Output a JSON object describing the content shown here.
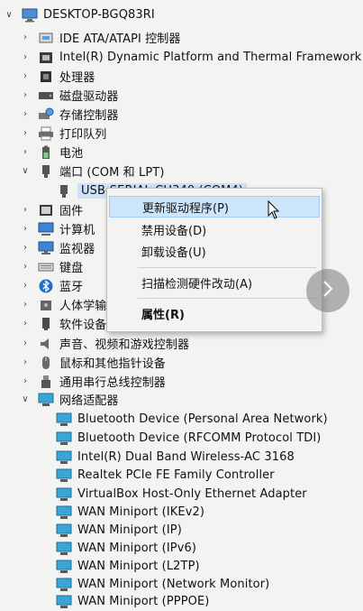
{
  "root": {
    "label": "DESKTOP-BGQ83RI"
  },
  "tree": {
    "collapsed": [
      {
        "name": "node-ide",
        "label": "IDE ATA/ATAPI 控制器",
        "icon": "ide-controller-icon"
      },
      {
        "name": "node-intel-dptf",
        "label": "Intel(R) Dynamic Platform and Thermal Framework",
        "icon": "intel-framework-icon"
      },
      {
        "name": "node-processor",
        "label": "处理器",
        "icon": "processor-icon"
      },
      {
        "name": "node-disk-drives",
        "label": "磁盘驱动器",
        "icon": "disk-drive-icon"
      },
      {
        "name": "node-storage-controllers",
        "label": "存储控制器",
        "icon": "storage-controller-icon"
      },
      {
        "name": "node-print-queues",
        "label": "打印队列",
        "icon": "printer-icon"
      },
      {
        "name": "node-battery",
        "label": "电池",
        "icon": "battery-icon"
      }
    ],
    "ports": {
      "label": "端口 (COM 和 LPT)",
      "child": "USB-SERIAL CH340 (COM4)"
    },
    "after_ports": [
      {
        "name": "node-firmware",
        "label": "固件",
        "icon": "firmware-icon"
      },
      {
        "name": "node-computer",
        "label": "计算机",
        "icon": "computer-icon"
      },
      {
        "name": "node-monitors",
        "label": "监视器",
        "icon": "monitor-icon"
      },
      {
        "name": "node-keyboards",
        "label": "键盘",
        "icon": "keyboard-icon"
      },
      {
        "name": "node-bluetooth",
        "label": "蓝牙",
        "icon": "bluetooth-icon"
      },
      {
        "name": "node-hid",
        "label": "人体学输入设备",
        "icon": "hid-icon"
      },
      {
        "name": "node-software-devices",
        "label": "软件设备",
        "icon": "software-device-icon"
      },
      {
        "name": "node-audio",
        "label": "声音、视频和游戏控制器",
        "icon": "speaker-icon"
      },
      {
        "name": "node-mice",
        "label": "鼠标和其他指针设备",
        "icon": "mouse-icon"
      },
      {
        "name": "node-usb",
        "label": "通用串行总线控制器",
        "icon": "usb-icon"
      }
    ],
    "network": {
      "label": "网络适配器",
      "children": [
        "Bluetooth Device (Personal Area Network)",
        "Bluetooth Device (RFCOMM Protocol TDI)",
        "Intel(R) Dual Band Wireless-AC 3168",
        "Realtek PCIe FE Family Controller",
        "VirtualBox Host-Only Ethernet Adapter",
        "WAN Miniport (IKEv2)",
        "WAN Miniport (IP)",
        "WAN Miniport (IPv6)",
        "WAN Miniport (L2TP)",
        "WAN Miniport (Network Monitor)",
        "WAN Miniport (PPPOE)"
      ]
    }
  },
  "context_menu": {
    "update_driver": "更新驱动程序(P)",
    "disable_device": "禁用设备(D)",
    "uninstall_device": "卸载设备(U)",
    "scan_hardware": "扫描检测硬件改动(A)",
    "properties": "属性(R)"
  },
  "colors": {
    "background": "#f3f3f1",
    "menu_hover": "#cde5fb",
    "selection": "#cfe1f6"
  }
}
